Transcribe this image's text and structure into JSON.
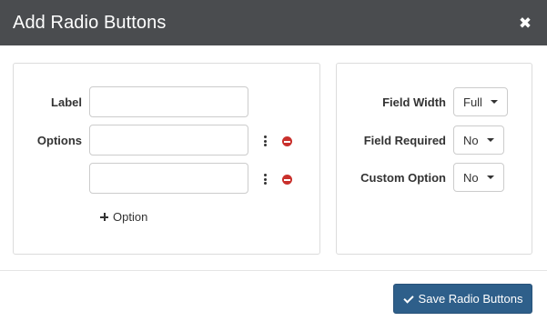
{
  "dialog": {
    "title": "Add Radio Buttons",
    "close_glyph": "✖"
  },
  "left_panel": {
    "label_field": {
      "label": "Label",
      "value": "",
      "placeholder": ""
    },
    "options_field": {
      "label": "Options",
      "inputs": [
        {
          "value": "",
          "placeholder": ""
        },
        {
          "value": "",
          "placeholder": ""
        }
      ]
    },
    "add_option_label": "Option"
  },
  "right_panel": {
    "field_width": {
      "label": "Field Width",
      "selected": "Full"
    },
    "field_required": {
      "label": "Field Required",
      "selected": "No"
    },
    "custom_option": {
      "label": "Custom Option",
      "selected": "No"
    }
  },
  "footer": {
    "save_label": "Save Radio Buttons"
  },
  "colors": {
    "header_bg": "#4a4c4f",
    "save_button_bg": "#2e5f8a",
    "remove_icon": "#c9302c"
  },
  "icons": [
    "close-icon",
    "kebab-icon",
    "remove-icon",
    "plus-icon",
    "caret-down-icon",
    "check-icon"
  ]
}
